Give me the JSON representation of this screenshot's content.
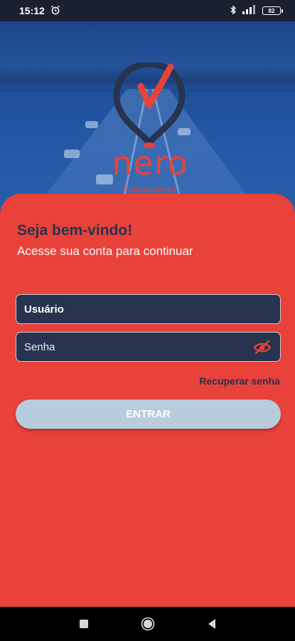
{
  "status_bar": {
    "time": "15:12",
    "battery": "82",
    "icons": [
      "alarm-icon",
      "bluetooth-icon",
      "signal-icon",
      "battery-icon"
    ]
  },
  "brand": {
    "name": "nero",
    "subtitle": "Rastreamento",
    "color": "#e8423a",
    "dark_color": "#27334f"
  },
  "login": {
    "title": "Seja bem-vindo!",
    "subtitle": "Acesse sua conta para continuar",
    "username_placeholder": "Usuário",
    "password_placeholder": "Senha",
    "recover_label": "Recuperar senha",
    "submit_label": "ENTRAR"
  },
  "nav": {
    "icons": [
      "recents-square-icon",
      "home-circle-icon",
      "back-triangle-icon"
    ]
  }
}
